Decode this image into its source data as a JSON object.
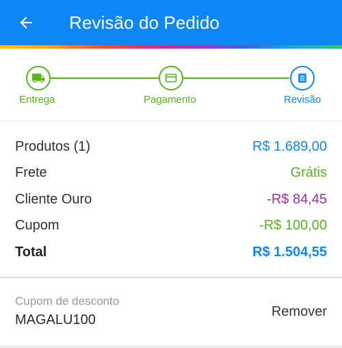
{
  "appbar": {
    "title": "Revisão do Pedido",
    "back_icon": "arrow-left-icon"
  },
  "colors": {
    "primary": "#0c87f5",
    "success": "#56b51c",
    "purple": "#9b2f9e"
  },
  "stepper": {
    "steps": [
      {
        "label": "Entrega",
        "icon": "truck-icon",
        "state": "done"
      },
      {
        "label": "Pagamento",
        "icon": "credit-card-icon",
        "state": "done"
      },
      {
        "label": "Revisão",
        "icon": "document-list-icon",
        "state": "current"
      }
    ]
  },
  "summary": {
    "rows": [
      {
        "label": "Produtos (1)",
        "value": "R$ 1.689,00",
        "color": "#0c87f5"
      },
      {
        "label": "Frete",
        "value": "Grátis",
        "color": "#56b51c"
      },
      {
        "label": "Cliente Ouro",
        "value": "-R$ 84,45",
        "color": "#9b2f9e"
      },
      {
        "label": "Cupom",
        "value": "-R$ 100,00",
        "color": "#56b51c"
      }
    ],
    "total": {
      "label": "Total",
      "value": "R$ 1.504,55",
      "color": "#0c87f5"
    }
  },
  "coupon": {
    "label": "Cupom de desconto",
    "code": "MAGALU100",
    "remove_label": "Remover"
  }
}
